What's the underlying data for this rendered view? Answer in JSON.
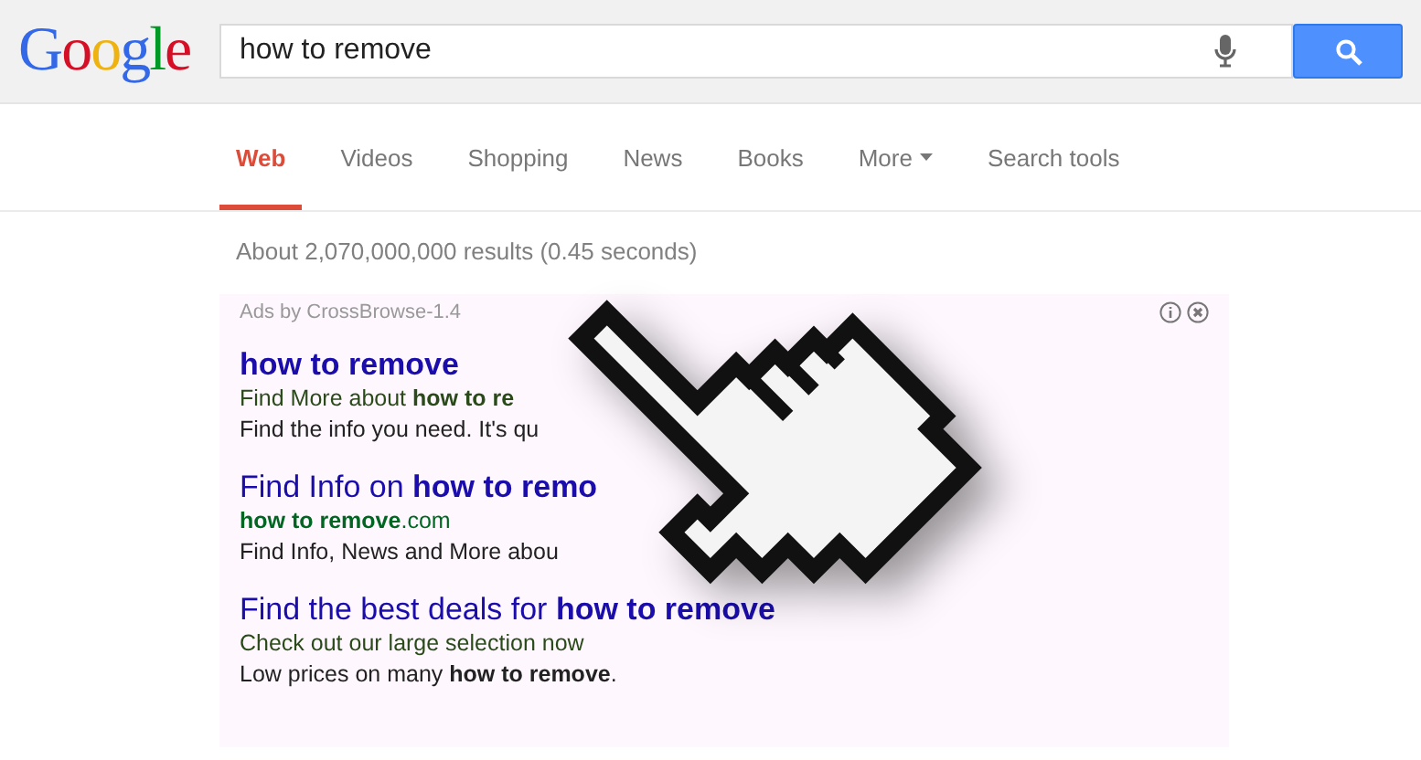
{
  "header": {
    "logo": "Google",
    "search": {
      "value": "how to remove"
    }
  },
  "tabs": [
    {
      "label": "Web",
      "selected": true,
      "has_menu": false
    },
    {
      "label": "Videos",
      "selected": false,
      "has_menu": false
    },
    {
      "label": "Shopping",
      "selected": false,
      "has_menu": false
    },
    {
      "label": "News",
      "selected": false,
      "has_menu": false
    },
    {
      "label": "Books",
      "selected": false,
      "has_menu": false
    },
    {
      "label": "More",
      "selected": false,
      "has_menu": true
    },
    {
      "label": "Search tools",
      "selected": false,
      "has_menu": false
    }
  ],
  "result_stats": "About 2,070,000,000 results (0.45 seconds)",
  "ads": {
    "label": "Ads by CrossBrowse-1.4",
    "items": [
      {
        "title": "**how to remove**",
        "lines": [
          {
            "kind": "snippet",
            "text": "Find More about **how to re**"
          },
          {
            "kind": "description",
            "text": "Find the info you need. It's qu"
          }
        ]
      },
      {
        "title": "Find Info on **how to remo**",
        "lines": [
          {
            "kind": "url",
            "text": "**how to remove**.com"
          },
          {
            "kind": "description",
            "text": "Find Info, News and More abou"
          }
        ]
      },
      {
        "title": "Find the best deals for **how to remove**",
        "lines": [
          {
            "kind": "snippet",
            "text": "Check out our large selection now"
          },
          {
            "kind": "description",
            "text": "Low prices on many **how to remove**."
          }
        ]
      }
    ]
  }
}
